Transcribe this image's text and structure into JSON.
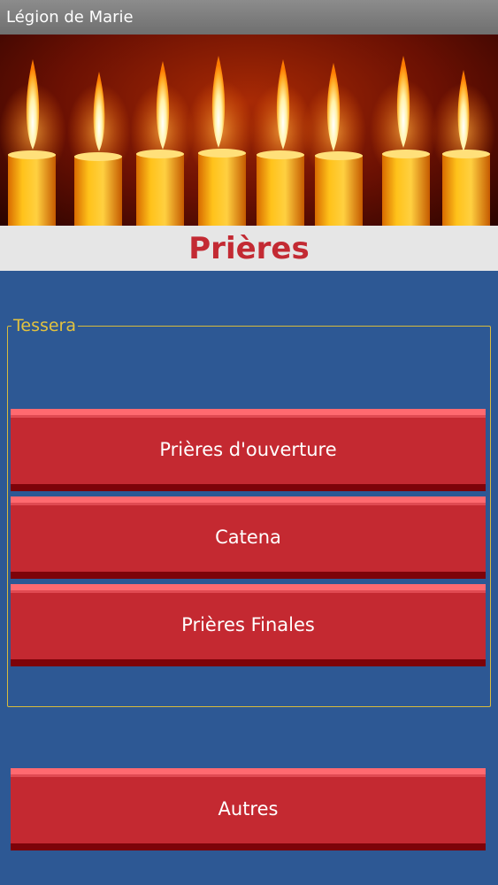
{
  "app": {
    "title": "Légion de Marie"
  },
  "page": {
    "title": "Prières"
  },
  "tessera": {
    "legend": "Tessera",
    "buttons": [
      {
        "label": "Prières d'ouverture"
      },
      {
        "label": "Catena"
      },
      {
        "label": "Prières Finales"
      }
    ]
  },
  "others": {
    "label": "Autres"
  },
  "colors": {
    "background": "#2d5894",
    "accent_red": "#c42931",
    "legend_gold": "#e2c23f",
    "title_red": "#c32a33"
  }
}
